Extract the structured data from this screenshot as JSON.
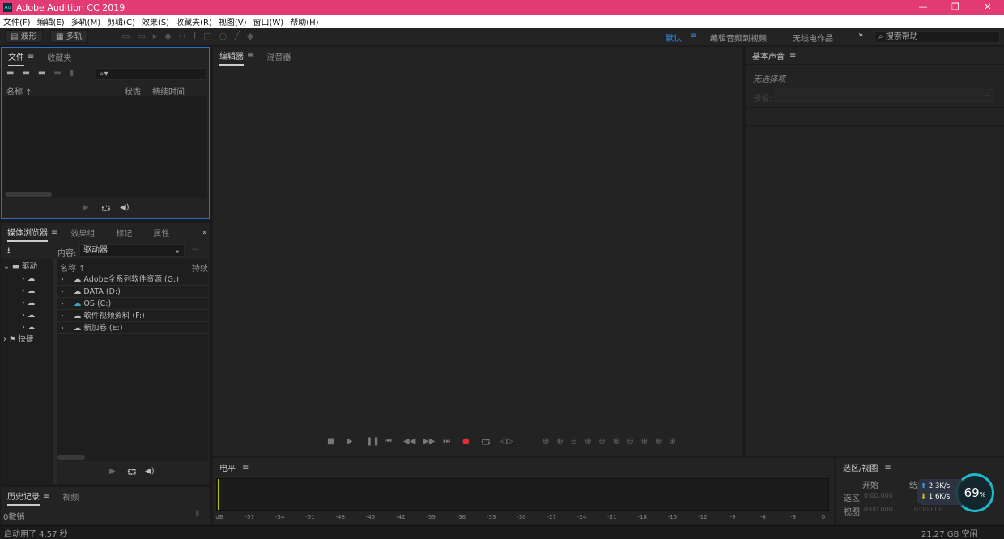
{
  "title": "Adobe Audition CC 2019",
  "logo": "Au",
  "window_controls": [
    "—",
    "❐",
    "✕"
  ],
  "menu": [
    "文件(F)",
    "编辑(E)",
    "多轨(M)",
    "剪辑(C)",
    "效果(S)",
    "收藏夹(R)",
    "视图(V)",
    "窗口(W)",
    "帮助(H)"
  ],
  "toolbar": {
    "waveform": "波形",
    "multitrack": "多轨",
    "workspaces": [
      "默认",
      "编辑音频到视频",
      "无线电作品"
    ],
    "more": "»",
    "search_placeholder": "搜索帮助"
  },
  "files_panel": {
    "tabs": [
      "文件",
      "收藏夹"
    ],
    "columns": [
      "名称 ↑",
      "状态",
      "持续时间"
    ]
  },
  "media_panel": {
    "tabs": [
      "媒体浏览器",
      "效果组",
      "标记",
      "属性"
    ],
    "content_label": "内容:",
    "content_value": "驱动器",
    "tree_root": "驱动",
    "tree_quick": "快捷",
    "col_name": "名称 ↑",
    "col_duration": "持续",
    "drives": [
      "Adobe全系列软件资源 (G:)",
      "DATA (D:)",
      "OS (C:)",
      "软件视频资料 (F:)",
      "新加卷 (E:)"
    ]
  },
  "history_panel": {
    "tabs": [
      "历史记录",
      "视频"
    ],
    "undo": "0撤销"
  },
  "editor_panel": {
    "tabs": [
      "编辑器",
      "混音器"
    ]
  },
  "essential_sound": {
    "title": "基本声音",
    "no_selection": "无选择项",
    "preset_label": "预设:"
  },
  "levels": {
    "title": "电平",
    "ticks": [
      "dB",
      "-57",
      "-54",
      "-51",
      "-48",
      "-45",
      "-42",
      "-39",
      "-36",
      "-33",
      "-30",
      "-27",
      "-24",
      "-21",
      "-18",
      "-15",
      "-12",
      "-9",
      "-6",
      "-3",
      "0"
    ]
  },
  "selection_view": {
    "title": "选区/视图",
    "col_start": "开始",
    "col_end": "结",
    "row_selection": "选区",
    "row_view": "视图",
    "sel_start": "0:00.000",
    "view_start": "0:00.000",
    "view_end": "0:00.000"
  },
  "network": {
    "up": "2.3K/s",
    "down": "1.6K/s",
    "percent": "69",
    "percent_sign": "%"
  },
  "status": {
    "startup": "启动用了 4.57 秒",
    "free_space": "21.27 GB 空闲"
  },
  "colors": {
    "titlebar": "#e23a72",
    "accent": "#2d8ceb",
    "record": "#e03030",
    "meter": "#b8c020"
  }
}
